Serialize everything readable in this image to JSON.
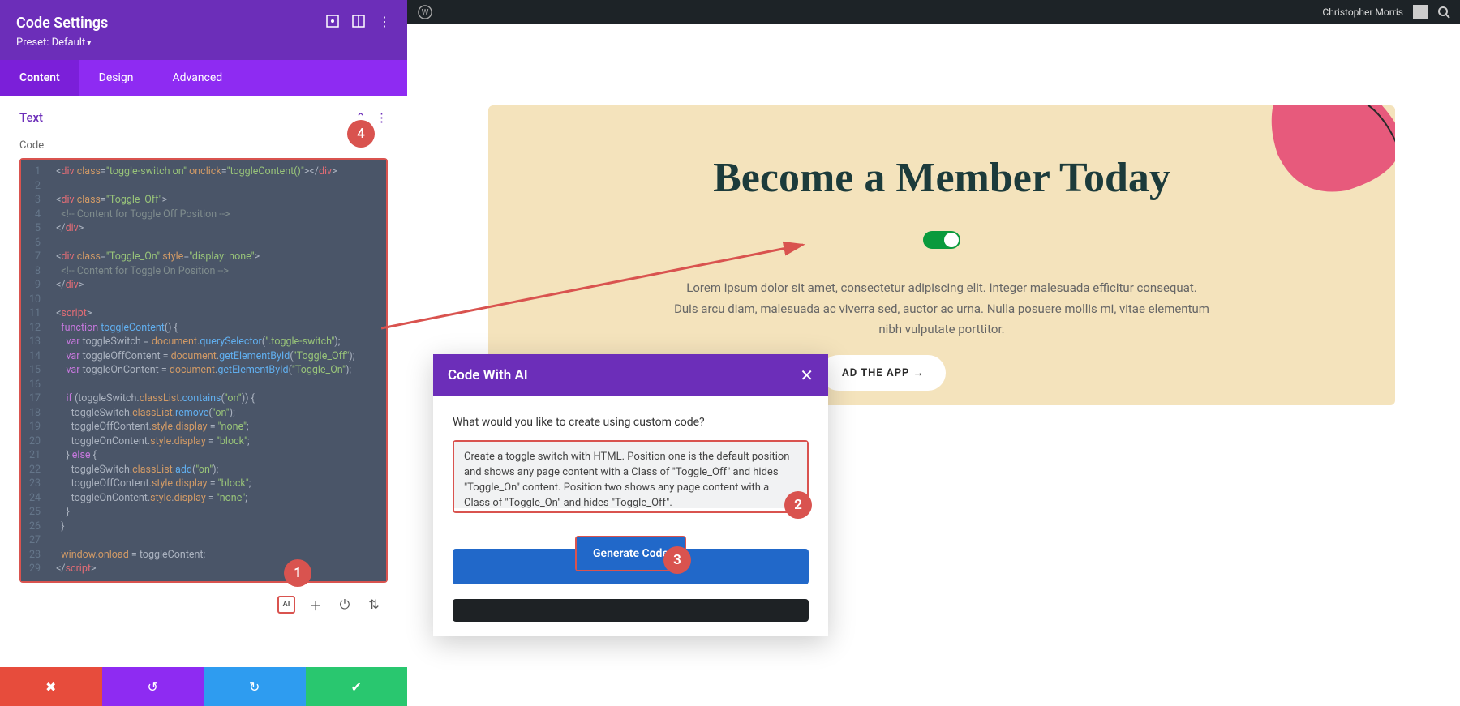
{
  "sidebar": {
    "title": "Code Settings",
    "preset_label": "Preset: Default",
    "tabs": {
      "content": "Content",
      "design": "Design",
      "advanced": "Advanced"
    },
    "section_title": "Text",
    "code_label": "Code",
    "ai_label": "AI"
  },
  "code": {
    "lines": [
      {
        "n": 1,
        "html": "<span class='tok-punc'>&lt;</span><span class='tok-tag'>div</span> <span class='tok-attr'>class</span>=<span class='tok-str'>\"toggle-switch on\"</span> <span class='tok-attr'>onclick</span>=<span class='tok-str'>\"toggleContent()\"</span><span class='tok-punc'>&gt;&lt;/</span><span class='tok-tag'>div</span><span class='tok-punc'>&gt;</span>"
      },
      {
        "n": 2,
        "html": ""
      },
      {
        "n": 3,
        "html": "<span class='tok-punc'>&lt;</span><span class='tok-tag'>div</span> <span class='tok-attr'>class</span>=<span class='tok-str'>\"Toggle_Off\"</span><span class='tok-punc'>&gt;</span>"
      },
      {
        "n": 4,
        "html": "  <span class='tok-com'>&lt;!-- Content for Toggle Off Position --&gt;</span>"
      },
      {
        "n": 5,
        "html": "<span class='tok-punc'>&lt;/</span><span class='tok-tag'>div</span><span class='tok-punc'>&gt;</span>"
      },
      {
        "n": 6,
        "html": ""
      },
      {
        "n": 7,
        "html": "<span class='tok-punc'>&lt;</span><span class='tok-tag'>div</span> <span class='tok-attr'>class</span>=<span class='tok-str'>\"Toggle_On\"</span> <span class='tok-attr'>style</span>=<span class='tok-str'>\"display: none\"</span><span class='tok-punc'>&gt;</span>"
      },
      {
        "n": 8,
        "html": "  <span class='tok-com'>&lt;!-- Content for Toggle On Position --&gt;</span>"
      },
      {
        "n": 9,
        "html": "<span class='tok-punc'>&lt;/</span><span class='tok-tag'>div</span><span class='tok-punc'>&gt;</span>"
      },
      {
        "n": 10,
        "html": ""
      },
      {
        "n": 11,
        "html": "<span class='tok-punc'>&lt;</span><span class='tok-tag'>script</span><span class='tok-punc'>&gt;</span>"
      },
      {
        "n": 12,
        "html": "  <span class='tok-kw'>function</span> <span class='tok-fn'>toggleContent</span>() {"
      },
      {
        "n": 13,
        "html": "    <span class='tok-kw'>var</span> toggleSwitch = <span class='tok-attr'>document</span>.<span class='tok-fn'>querySelector</span>(<span class='tok-str'>\".toggle-switch\"</span>);"
      },
      {
        "n": 14,
        "html": "    <span class='tok-kw'>var</span> toggleOffContent = <span class='tok-attr'>document</span>.<span class='tok-fn'>getElementById</span>(<span class='tok-str'>\"Toggle_Off\"</span>);"
      },
      {
        "n": 15,
        "html": "    <span class='tok-kw'>var</span> toggleOnContent = <span class='tok-attr'>document</span>.<span class='tok-fn'>getElementById</span>(<span class='tok-str'>\"Toggle_On\"</span>);"
      },
      {
        "n": 16,
        "html": ""
      },
      {
        "n": 17,
        "html": "    <span class='tok-kw'>if</span> (toggleSwitch.<span class='tok-attr'>classList</span>.<span class='tok-fn'>contains</span>(<span class='tok-str'>\"on\"</span>)) {"
      },
      {
        "n": 18,
        "html": "      toggleSwitch.<span class='tok-attr'>classList</span>.<span class='tok-fn'>remove</span>(<span class='tok-str'>\"on\"</span>);"
      },
      {
        "n": 19,
        "html": "      toggleOffContent.<span class='tok-attr'>style</span>.<span class='tok-attr'>display</span> = <span class='tok-str'>\"none\"</span>;"
      },
      {
        "n": 20,
        "html": "      toggleOnContent.<span class='tok-attr'>style</span>.<span class='tok-attr'>display</span> = <span class='tok-str'>\"block\"</span>;"
      },
      {
        "n": 21,
        "html": "    } <span class='tok-kw'>else</span> {"
      },
      {
        "n": 22,
        "html": "      toggleSwitch.<span class='tok-attr'>classList</span>.<span class='tok-fn'>add</span>(<span class='tok-str'>\"on\"</span>);"
      },
      {
        "n": 23,
        "html": "      toggleOffContent.<span class='tok-attr'>style</span>.<span class='tok-attr'>display</span> = <span class='tok-str'>\"block\"</span>;"
      },
      {
        "n": 24,
        "html": "      toggleOnContent.<span class='tok-attr'>style</span>.<span class='tok-attr'>display</span> = <span class='tok-str'>\"none\"</span>;"
      },
      {
        "n": 25,
        "html": "    }"
      },
      {
        "n": 26,
        "html": "  }"
      },
      {
        "n": 27,
        "html": ""
      },
      {
        "n": 28,
        "html": "  <span class='tok-attr'>window</span>.<span class='tok-attr'>onload</span> = toggleContent;"
      },
      {
        "n": 29,
        "html": "<span class='tok-punc'>&lt;/</span><span class='tok-tag'>script</span><span class='tok-punc'>&gt;</span>"
      }
    ]
  },
  "wp": {
    "user": "Christopher Morris"
  },
  "hero": {
    "title": "Become a Member Today",
    "text": "Lorem ipsum dolor sit amet, consectetur adipiscing elit. Integer malesuada efficitur consequat. Duis arcu diam, malesuada ac viverra sed, auctor ac urna. Nulla posuere mollis mi, vitae elementum nibh vulputate porttitor.",
    "button": "AD THE APP →"
  },
  "modal": {
    "title": "Code With AI",
    "prompt": "What would you like to create using custom code?",
    "textarea": "Create a toggle switch with HTML. Position one is the default position and shows any page content with a Class of \"Toggle_Off\" and hides \"Toggle_On\" content. Position two shows any page content with a Class of \"Toggle_On\" and hides \"Toggle_Off\".",
    "generate": "Generate Code"
  },
  "badges": {
    "b1": "1",
    "b2": "2",
    "b3": "3",
    "b4": "4"
  }
}
